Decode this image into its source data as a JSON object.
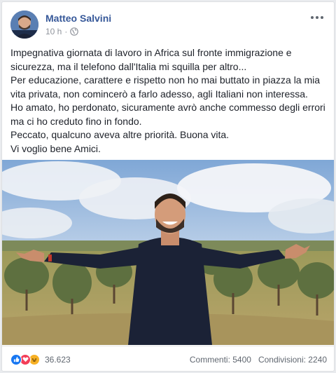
{
  "post": {
    "author": "Matteo Salvini",
    "time": "10 h",
    "separator": "·",
    "privacy_icon": "globe-icon",
    "more_icon": "more-options-icon",
    "text_lines": [
      "Impegnativa giornata di lavoro in Africa sul fronte immigrazione e",
      "sicurezza, ma il telefono dall'Italia mi squilla per altro...",
      "Per educazione, carattere e rispetto non ho mai buttato in piazza la mia",
      "vita privata, non comincerò a farlo adesso, agli Italiani non interessa.",
      "Ho amato, ho perdonato, sicuramente avrò anche commesso degli errori",
      "ma ci ho creduto fino in fondo.",
      "Peccato, qualcuno aveva altre priorità. Buona vita.",
      "Vi voglio bene Amici."
    ]
  },
  "footer": {
    "reactions": [
      "like-icon",
      "love-icon",
      "haha-icon"
    ],
    "reaction_count": "36.623",
    "comments": "Commenti: 5400",
    "shares": "Condivisioni: 2240"
  },
  "colors": {
    "author": "#365899",
    "like": "#1877f2",
    "love": "#f33e58",
    "haha": "#f7b125"
  }
}
